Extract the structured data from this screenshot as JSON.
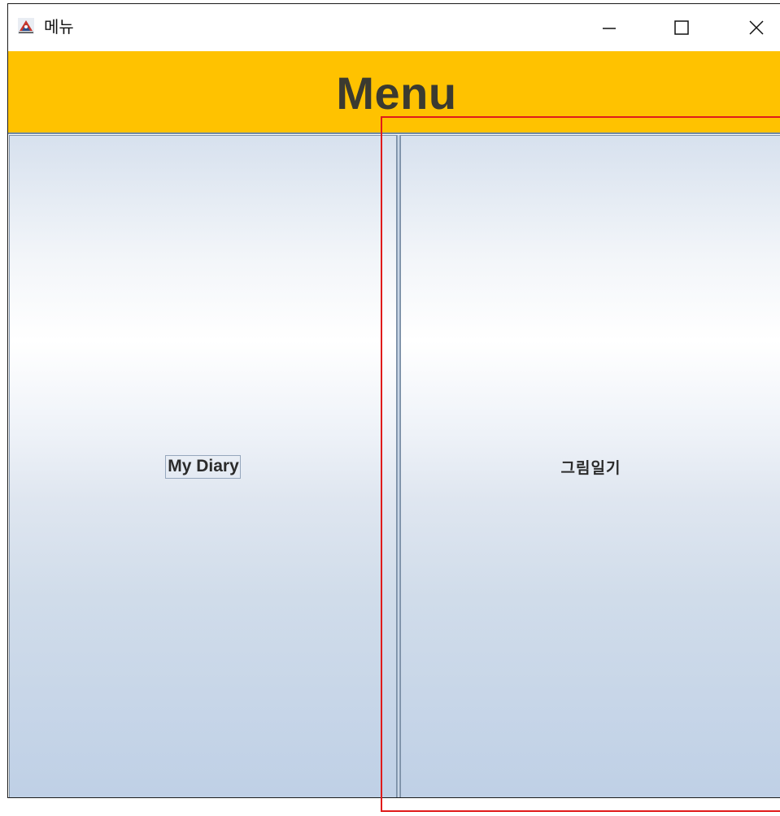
{
  "window": {
    "title": "메뉴",
    "app_icon": "java-app-icon",
    "controls": {
      "minimize_icon": "minimize-icon",
      "maximize_icon": "maximize-icon",
      "close_icon": "close-icon"
    }
  },
  "header": {
    "title": "Menu",
    "background_color": "#ffc200",
    "text_color": "#3b3a30"
  },
  "buttons": [
    {
      "label": "My Diary",
      "focused": true
    },
    {
      "label": "그림일기",
      "focused": false
    }
  ],
  "highlight": {
    "color": "#e01b1b"
  }
}
